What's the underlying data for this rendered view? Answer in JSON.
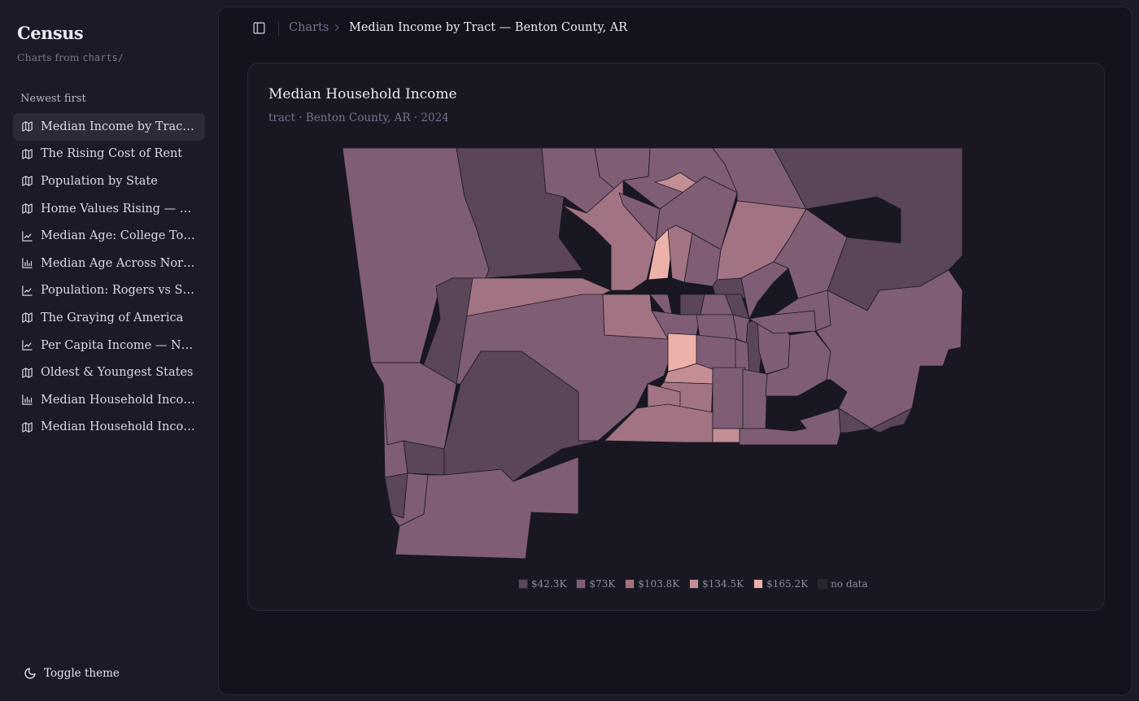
{
  "app": {
    "brand": "Census",
    "subtitle_prefix": "Charts from ",
    "subtitle_code": "charts/"
  },
  "sidebar": {
    "section_label": "Newest first",
    "items": [
      {
        "label": "Median Income by Tract — Benton County, AR",
        "icon": "map-icon",
        "active": true
      },
      {
        "label": "The Rising Cost of Rent",
        "icon": "map-icon"
      },
      {
        "label": "Population by State",
        "icon": "map-icon"
      },
      {
        "label": "Home Values Rising — Arkansas",
        "icon": "map-icon"
      },
      {
        "label": "Median Age: College Towns",
        "icon": "line-chart-icon"
      },
      {
        "label": "Median Age Across Northwest Arkansas",
        "icon": "bar-chart-icon"
      },
      {
        "label": "Population: Rogers vs Springdale",
        "icon": "line-chart-icon"
      },
      {
        "label": "The Graying of America",
        "icon": "map-icon"
      },
      {
        "label": "Per Capita Income — Northwest Arkansas",
        "icon": "line-chart-icon"
      },
      {
        "label": "Oldest & Youngest States",
        "icon": "map-icon"
      },
      {
        "label": "Median Household Income",
        "icon": "bar-chart-icon"
      },
      {
        "label": "Median Household Income",
        "icon": "map-icon"
      }
    ],
    "theme_toggle": "Toggle theme"
  },
  "breadcrumb": {
    "root": "Charts",
    "current": "Median Income by Tract — Benton County, AR"
  },
  "chart_card": {
    "title": "Median Household Income",
    "subtitle": "tract · Benton County, AR · 2024"
  },
  "chart_data": {
    "type": "choropleth",
    "title": "Median Household Income",
    "geography": "tract",
    "region": "Benton County, AR",
    "year": "2024",
    "legend": [
      {
        "label": "$42.3K",
        "value": 42300,
        "color": "#5b4558"
      },
      {
        "label": "$73K",
        "value": 73000,
        "color": "#7f5d74"
      },
      {
        "label": "$103.8K",
        "value": 103800,
        "color": "#a27382"
      },
      {
        "label": "$134.5K",
        "value": 134500,
        "color": "#c48e95"
      },
      {
        "label": "$165.2K",
        "value": 165200,
        "color": "#ecb1a8"
      },
      {
        "label": "no data",
        "value": null,
        "color": "#26242f"
      }
    ],
    "legend_placement": "bottom-center"
  },
  "colors": {
    "background": "#1c1a26",
    "panel": "#14121c",
    "card": "#191722",
    "text": "#ece8f2",
    "muted": "#77728a"
  }
}
